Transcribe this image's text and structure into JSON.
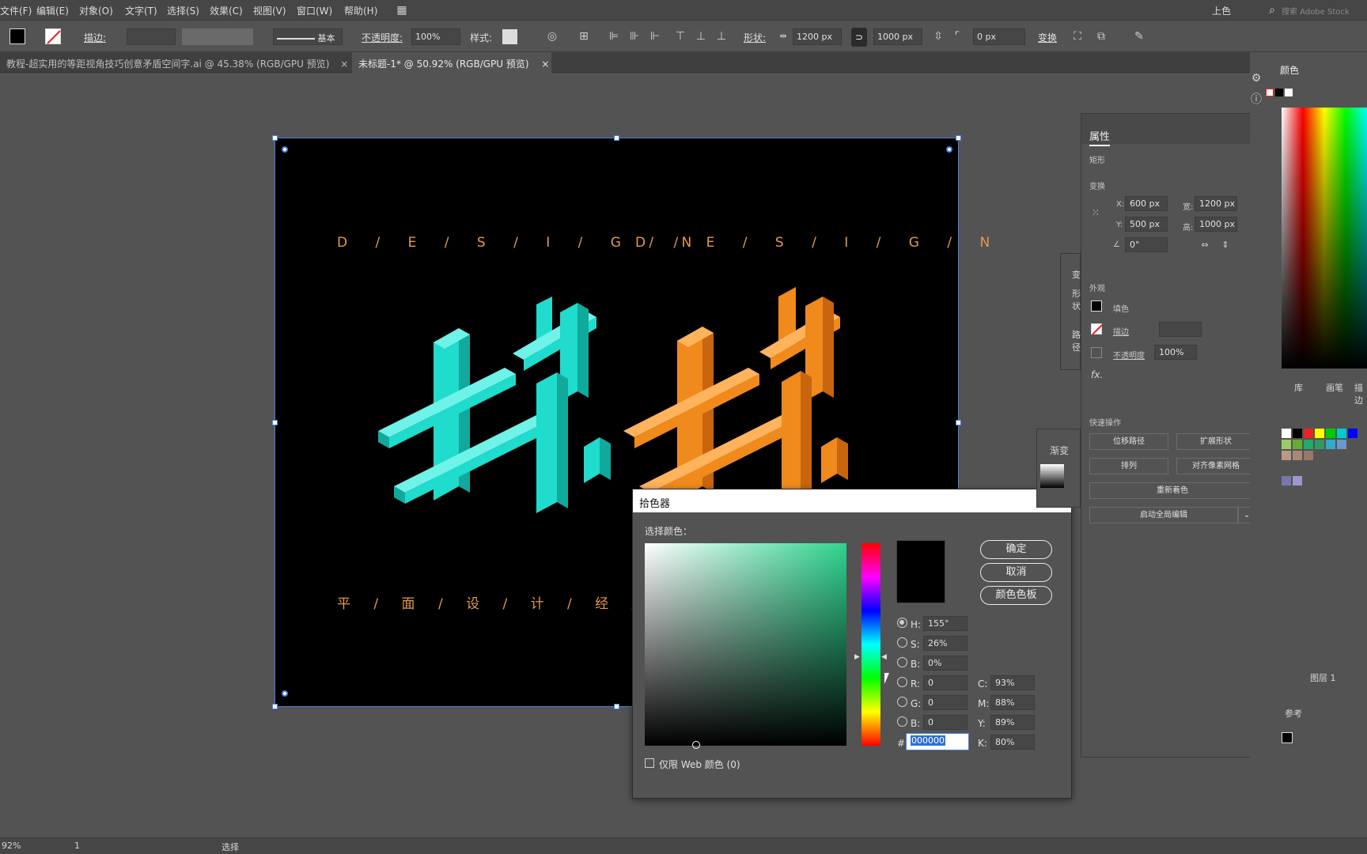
{
  "menubar": {
    "items": [
      "文件(F)",
      "编辑(E)",
      "对象(O)",
      "文字(T)",
      "选择(S)",
      "效果(C)",
      "视图(V)",
      "窗口(W)",
      "帮助(H)"
    ],
    "workspace": "上色",
    "search_placeholder": "搜索 Adobe Stock"
  },
  "control": {
    "stroke_label": "描边:",
    "brush_label": "基本",
    "opacity_label": "不透明度:",
    "opacity_value": "100%",
    "style_label": "样式:",
    "shape_label": "形状:",
    "width_value": "1200 px",
    "height_value": "1000 px",
    "corner_value": "0 px",
    "transform_label": "变换"
  },
  "tabs": [
    {
      "label": "教程-超实用的等距视角技巧创意矛盾空间字.ai @ 45.38% (RGB/GPU 预览)",
      "active": false
    },
    {
      "label": "未标题-1* @ 50.92% (RGB/GPU 预览)",
      "active": true
    }
  ],
  "artwork": {
    "design_left": "D / E / S / I / G / N",
    "design_right": "D / E / S / I / G / N",
    "bottom_text": "平 / 面 / 设 / 计 / 经 / 验",
    "colors": {
      "cyan": "#1fdccd",
      "cyan_dark": "#12a99d",
      "orange": "#f08a1c",
      "orange_dark": "#c9650e",
      "gold": "#e39a4b"
    }
  },
  "color_picker": {
    "title": "拾色器",
    "select_label": "选择颜色：",
    "ok": "确定",
    "cancel": "取消",
    "swatches": "颜色色板",
    "fields": {
      "H": "155°",
      "S": "26%",
      "Bv": "0%",
      "R": "0",
      "G": "0",
      "B": "0",
      "C": "93%",
      "M": "88%",
      "Y": "89%",
      "K": "80%",
      "hex": "000000"
    },
    "web_only": "仅限 Web 颜色 (0)"
  },
  "properties": {
    "tab": "属性",
    "object_type": "矩形",
    "transform": "变换",
    "x": "600 px",
    "y": "500 px",
    "w": "1200 px",
    "h": "1000 px",
    "angle": "0°",
    "appearance": "外观",
    "fill": "填色",
    "stroke": "描边",
    "opacity_label": "不透明度",
    "opacity": "100%",
    "quick_actions": "快速操作",
    "btn_offset": "位移路径",
    "btn_expand": "扩展形状",
    "btn_arrange": "排列",
    "btn_align_pixel": "对齐像素网格",
    "btn_recolor": "重新着色",
    "btn_global_edit": "启动全局编辑"
  },
  "right_panel": {
    "color_tab": "颜色",
    "tabs2": [
      "库",
      "画笔",
      "描边"
    ],
    "gradient": "渐变",
    "layer": "图层 1",
    "ref": "参考",
    "transform_partial": "变",
    "shape_partial": "形状",
    "path_partial": "路径"
  },
  "status": {
    "zoom": "92%",
    "page": "1",
    "mode": "选择"
  }
}
